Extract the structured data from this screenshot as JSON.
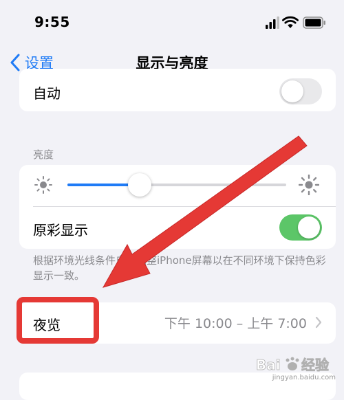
{
  "status_bar": {
    "time": "9:55"
  },
  "nav": {
    "back_label": "设置",
    "title": "显示与亮度"
  },
  "auto_row": {
    "label": "自动",
    "toggle_on": false
  },
  "brightness": {
    "section_label": "亮度",
    "level": 0.33
  },
  "true_tone": {
    "label": "原彩显示",
    "toggle_on": true,
    "footnote": "根据环境光线条件自动调整iPhone屏幕以在不同环境下保持色彩显示一致。"
  },
  "night_shift": {
    "label": "夜览",
    "value": "下午 10:00 – 上午 7:00"
  },
  "watermark": {
    "text": "jingyan.baidu.com"
  },
  "colors": {
    "accent": "#1f7bf6",
    "toggle_on": "#5cc668",
    "annotation": "#e53935"
  }
}
